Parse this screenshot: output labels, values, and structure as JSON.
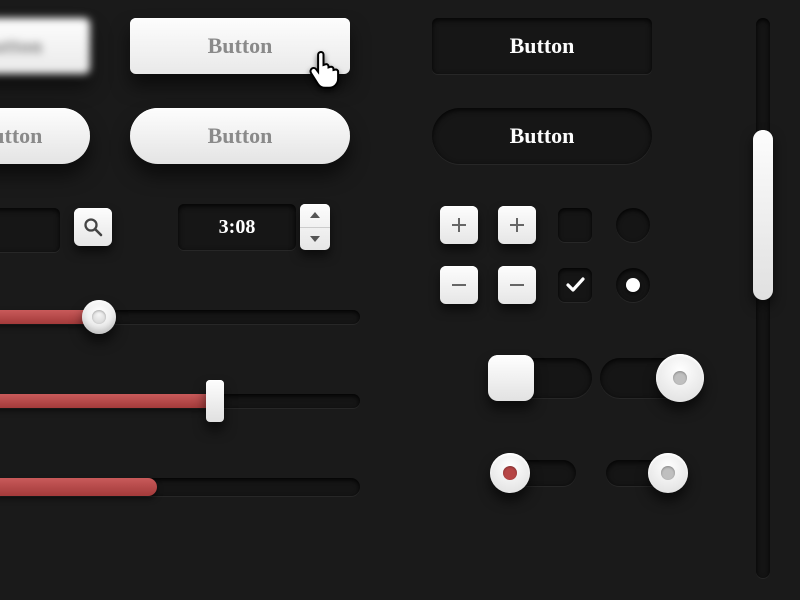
{
  "buttons": {
    "rect_light_cut": "Button",
    "rect_light_hover": "Button",
    "pill_light_cut": "Button",
    "pill_light": "Button",
    "rect_dark": "Button",
    "pill_dark": "Button"
  },
  "stepper": {
    "value": "3:08"
  },
  "sliders": {
    "slider1_percent": 28,
    "slider2_percent": 62,
    "progress_percent": 45
  },
  "toggles": {
    "square_on": false,
    "round_large_on": true,
    "round_small_left_state": "recording",
    "round_small_right_on": true
  },
  "checkbox": {
    "unchecked": false,
    "checked": true
  },
  "radio": {
    "unselected": false,
    "selected": true
  },
  "colors": {
    "accent_red": "#b64545",
    "bg": "#1a1a1a"
  }
}
